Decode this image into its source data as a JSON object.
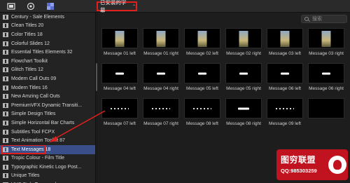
{
  "toolbar": {
    "icons": [
      "titles-generators-icon",
      "effects-icon",
      "themes-icon"
    ],
    "filter_label": "已安装的字幕",
    "filter_chevron": "⌃"
  },
  "sidebar": {
    "items": [
      {
        "label": "Century - Sale Elements"
      },
      {
        "label": "Clean Titles 20"
      },
      {
        "label": "Color Titles 18"
      },
      {
        "label": "Colorful Slides 12"
      },
      {
        "label": "Essential Titles Elements 32"
      },
      {
        "label": "Flowchart Toolkit"
      },
      {
        "label": "Glitch Titles 12"
      },
      {
        "label": "Modern Call Outs 09"
      },
      {
        "label": "Modern Titles 16"
      },
      {
        "label": "New Amzing Call Outs"
      },
      {
        "label": "PremiumVFX Dynamic Transiti..."
      },
      {
        "label": "Simple Design Titles"
      },
      {
        "label": "Simple Horizontal Bar Charts"
      },
      {
        "label": "Subtitles Tool FCPX"
      },
      {
        "label": "Text Animation Toolkit 87"
      },
      {
        "label": "Text Messages 18",
        "selected": true
      },
      {
        "label": "Tropic Colour - Film Title"
      },
      {
        "label": "Typographic Kinetic Logo Post..."
      },
      {
        "label": "Unique Titles"
      },
      {
        "label": "VHS Style Typography"
      }
    ]
  },
  "search": {
    "placeholder": "搜索"
  },
  "clips": [
    {
      "label": "Message 01 left",
      "thumb": "photo"
    },
    {
      "label": "Message 01 right",
      "thumb": "photo"
    },
    {
      "label": "Message 02 left",
      "thumb": "photo"
    },
    {
      "label": "Message 02 right",
      "thumb": "photo"
    },
    {
      "label": "Message 03 left",
      "thumb": "photo"
    },
    {
      "label": "Message 03 right",
      "thumb": "photo"
    },
    {
      "label": "Message 04 left",
      "thumb": "bar-small"
    },
    {
      "label": "Message 04 right",
      "thumb": "bar-small"
    },
    {
      "label": "Message 05 left",
      "thumb": "bar-small"
    },
    {
      "label": "Message 05 right",
      "thumb": "bar-small"
    },
    {
      "label": "Message 06 left",
      "thumb": "bar-small"
    },
    {
      "label": "Message 06 right",
      "thumb": "bar-small"
    },
    {
      "label": "Message 07 left",
      "thumb": "dots"
    },
    {
      "label": "Message 07 right",
      "thumb": "dots"
    },
    {
      "label": "Message 08 left",
      "thumb": "dots"
    },
    {
      "label": "Message 08 right",
      "thumb": "bar-wide"
    },
    {
      "label": "Message 09 left",
      "thumb": "dots"
    },
    {
      "label": "",
      "thumb": "partial"
    }
  ],
  "watermark": {
    "title": "图穷联盟",
    "subtitle": "QQ:985303259"
  },
  "colors": {
    "highlight": "#e0201c",
    "selection": "#3a4f8a",
    "watermark_bg": "#c1121f"
  }
}
